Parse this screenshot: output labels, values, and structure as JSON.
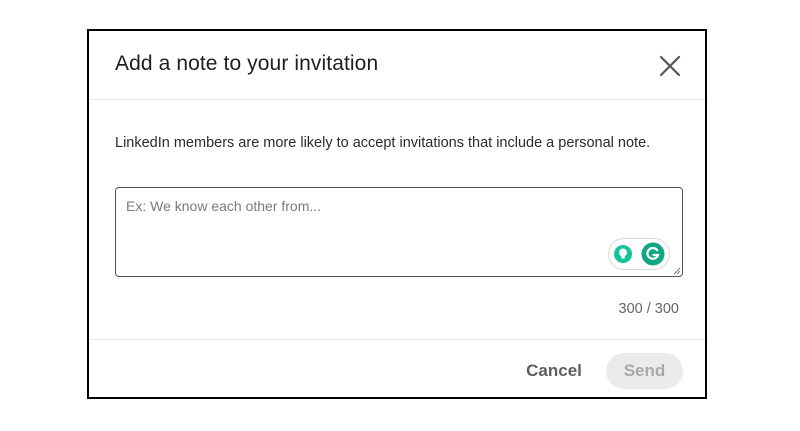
{
  "dialog": {
    "title": "Add a note to your invitation",
    "description": "LinkedIn members are more likely to accept invitations that include a personal note.",
    "note_placeholder": "Ex: We know each other from...",
    "note_value": "",
    "counter": "300 / 300",
    "cancel_label": "Cancel",
    "send_label": "Send"
  },
  "icons": {
    "close": "close-icon",
    "lightbulb": "lightbulb-icon",
    "grammarly": "grammarly-icon"
  },
  "colors": {
    "grammarly_green": "#15c39a",
    "grammarly_dark": "#11a683",
    "send_disabled_bg": "#ebebeb",
    "send_disabled_text": "#a8a8a8"
  }
}
